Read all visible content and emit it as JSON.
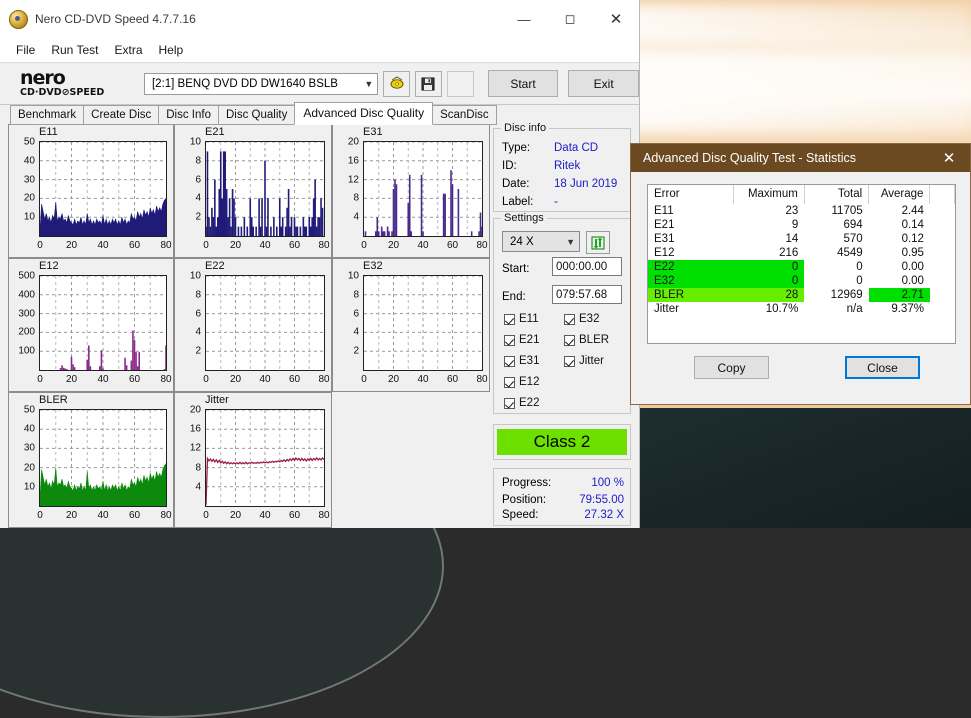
{
  "window": {
    "title": "Nero CD-DVD Speed 4.7.7.16",
    "app_icon": "nero-disc-icon",
    "minimize": "minimize-icon",
    "maximize": "maximize-icon",
    "close": "close-icon"
  },
  "menu": {
    "items": [
      "File",
      "Run Test",
      "Extra",
      "Help"
    ]
  },
  "brand": {
    "line1": "nero",
    "line2": "CD·DVD⊘SPEED",
    "drive_selected": "[2:1]   BENQ DVD DD DW1640 BSLB",
    "drive_caret": "chevron-down-icon",
    "tool_icon_1": "eject-disc-icon",
    "tool_icon_2": "save-floppy-icon",
    "start_label": "Start",
    "exit_label": "Exit"
  },
  "tabs": {
    "items": [
      "Benchmark",
      "Create Disc",
      "Disc Info",
      "Disc Quality",
      "Advanced Disc Quality",
      "ScanDisc"
    ],
    "active": "Advanced Disc Quality"
  },
  "disc_info": {
    "legend": "Disc info",
    "rows": [
      {
        "key": "Type:",
        "value": "Data CD"
      },
      {
        "key": "ID:",
        "value": "Ritek"
      },
      {
        "key": "Date:",
        "value": "18 Jun 2019"
      },
      {
        "key": "Label:",
        "value": "-"
      }
    ]
  },
  "settings": {
    "legend": "Settings",
    "speed_value": "24 X",
    "speed_caret": "chevron-down-icon",
    "refresh_icon": "refresh-speed-icon",
    "start_label": "Start:",
    "start_value": "000:00.00",
    "end_label": "End:",
    "end_value": "079:57.68",
    "checks_left": [
      "E11",
      "E21",
      "E31",
      "E12",
      "E22"
    ],
    "checks_right": [
      "E32",
      "BLER",
      "Jitter"
    ]
  },
  "class_badge": {
    "label": "Class 2",
    "color": "#6de000"
  },
  "status": {
    "rows": [
      {
        "key": "Progress:",
        "value": "100 %"
      },
      {
        "key": "Position:",
        "value": "79:55.00"
      },
      {
        "key": "Speed:",
        "value": "27.32 X"
      }
    ]
  },
  "dialog": {
    "title": "Advanced Disc Quality Test - Statistics",
    "close_icon": "close-icon",
    "columns": [
      "Error",
      "Maximum",
      "Total",
      "Average"
    ],
    "rows": [
      {
        "error": "E11",
        "maximum": "23",
        "total": "11705",
        "average": "2.44",
        "hl": "none"
      },
      {
        "error": "E21",
        "maximum": "9",
        "total": "694",
        "average": "0.14",
        "hl": "none"
      },
      {
        "error": "E31",
        "maximum": "14",
        "total": "570",
        "average": "0.12",
        "hl": "none"
      },
      {
        "error": "E12",
        "maximum": "216",
        "total": "4549",
        "average": "0.95",
        "hl": "none"
      },
      {
        "error": "E22",
        "maximum": "0",
        "total": "0",
        "average": "0.00",
        "hl": "green"
      },
      {
        "error": "E32",
        "maximum": "0",
        "total": "0",
        "average": "0.00",
        "hl": "green"
      },
      {
        "error": "BLER",
        "maximum": "28",
        "total": "12969",
        "average": "2.71",
        "hl": "lime-avg"
      },
      {
        "error": "Jitter",
        "maximum": "10.7%",
        "total": "n/a",
        "average": "9.37%",
        "hl": "none"
      }
    ],
    "copy_label": "Copy",
    "close_label": "Close",
    "highlight_green": "#00e000",
    "highlight_lime": "#66ee00"
  },
  "chart_data": [
    {
      "type": "area",
      "title": "E11",
      "color": "#201a78",
      "xlabel": "",
      "ylabel": "",
      "xlim": [
        0,
        80
      ],
      "ylim": [
        0,
        50
      ],
      "xticks": [
        0,
        20,
        40,
        60,
        80
      ],
      "yticks": [
        10,
        20,
        30,
        40,
        50
      ],
      "grid": true,
      "x": [
        0,
        1,
        2,
        3,
        4,
        5,
        6,
        7,
        8,
        9,
        10,
        11,
        12,
        13,
        14,
        15,
        16,
        17,
        18,
        19,
        20,
        21,
        22,
        23,
        24,
        25,
        26,
        27,
        28,
        29,
        30,
        31,
        32,
        33,
        34,
        35,
        36,
        37,
        38,
        39,
        40,
        41,
        42,
        43,
        44,
        45,
        46,
        47,
        48,
        49,
        50,
        51,
        52,
        53,
        54,
        55,
        56,
        57,
        58,
        59,
        60,
        61,
        62,
        63,
        64,
        65,
        66,
        67,
        68,
        69,
        70,
        71,
        72,
        73,
        74,
        75,
        76,
        77,
        78,
        79,
        80
      ],
      "values": [
        3,
        17,
        13,
        9,
        12,
        8,
        10,
        7,
        11,
        9,
        18,
        8,
        10,
        9,
        12,
        8,
        9,
        7,
        11,
        8,
        7,
        6,
        9,
        6,
        8,
        7,
        10,
        6,
        8,
        6,
        12,
        7,
        9,
        6,
        8,
        6,
        9,
        7,
        8,
        6,
        11,
        6,
        9,
        6,
        8,
        6,
        9,
        7,
        9,
        6,
        8,
        6,
        10,
        7,
        9,
        6,
        8,
        7,
        12,
        9,
        10,
        8,
        13,
        10,
        12,
        9,
        14,
        11,
        13,
        10,
        15,
        12,
        14,
        11,
        16,
        13,
        15,
        13,
        17,
        19,
        20
      ]
    },
    {
      "type": "bar",
      "title": "E21",
      "color": "#201a78",
      "xlim": [
        0,
        80
      ],
      "ylim": [
        0,
        10
      ],
      "xticks": [
        0,
        20,
        40,
        60,
        80
      ],
      "yticks": [
        2,
        4,
        6,
        8,
        10
      ],
      "grid": true,
      "x": [
        0,
        1,
        2,
        3,
        4,
        5,
        6,
        7,
        8,
        9,
        10,
        11,
        12,
        13,
        14,
        15,
        16,
        17,
        18,
        19,
        20,
        21,
        22,
        23,
        24,
        25,
        26,
        27,
        28,
        29,
        30,
        31,
        32,
        33,
        34,
        35,
        36,
        37,
        38,
        39,
        40,
        41,
        42,
        43,
        44,
        45,
        46,
        47,
        48,
        49,
        50,
        51,
        52,
        53,
        54,
        55,
        56,
        57,
        58,
        59,
        60,
        61,
        62,
        63,
        64,
        65,
        66,
        67,
        68,
        69,
        70,
        71,
        72,
        73,
        74,
        75,
        76,
        77,
        78,
        79,
        80
      ],
      "values": [
        1,
        9,
        2,
        1,
        3,
        2,
        6,
        1,
        2,
        5,
        9,
        4,
        9,
        9,
        5,
        2,
        4,
        1,
        5,
        4,
        2,
        0,
        1,
        0,
        1,
        0,
        2,
        0,
        1,
        0,
        4,
        2,
        1,
        0,
        1,
        0,
        4,
        1,
        4,
        0,
        8,
        1,
        4,
        0,
        1,
        0,
        2,
        0,
        1,
        0,
        4,
        1,
        2,
        0,
        1,
        3,
        5,
        1,
        2,
        0,
        2,
        1,
        1,
        0,
        1,
        0,
        2,
        1,
        1,
        0,
        2,
        1,
        2,
        4,
        6,
        1,
        2,
        2,
        4,
        3,
        0
      ]
    },
    {
      "type": "bar",
      "title": "E31",
      "color": "#4a2a8c",
      "xlim": [
        0,
        80
      ],
      "ylim": [
        0,
        20
      ],
      "xticks": [
        0,
        20,
        40,
        60,
        80
      ],
      "yticks": [
        4,
        8,
        12,
        16,
        20
      ],
      "grid": true,
      "x": [
        0,
        1,
        2,
        3,
        4,
        5,
        6,
        7,
        8,
        9,
        10,
        11,
        12,
        13,
        14,
        15,
        16,
        17,
        18,
        19,
        20,
        21,
        22,
        23,
        24,
        25,
        26,
        27,
        28,
        29,
        30,
        31,
        32,
        33,
        34,
        35,
        36,
        37,
        38,
        39,
        40,
        41,
        42,
        43,
        44,
        45,
        46,
        47,
        48,
        49,
        50,
        51,
        52,
        53,
        54,
        55,
        56,
        57,
        58,
        59,
        60,
        61,
        62,
        63,
        64,
        65,
        66,
        67,
        68,
        69,
        70,
        71,
        72,
        73,
        74,
        75,
        76,
        77,
        78,
        79,
        80
      ],
      "values": [
        0,
        1,
        0,
        0,
        0,
        0,
        0,
        0,
        1,
        4,
        1,
        0,
        2,
        1,
        1,
        0,
        2,
        1,
        0,
        1,
        10,
        12,
        11,
        0,
        0,
        0,
        0,
        0,
        0,
        0,
        7,
        13,
        1,
        0,
        0,
        0,
        0,
        0,
        0,
        13,
        1,
        0,
        0,
        0,
        0,
        0,
        0,
        0,
        0,
        0,
        0,
        0,
        0,
        0,
        9,
        9,
        0,
        0,
        0,
        14,
        11,
        0,
        0,
        0,
        10,
        0,
        0,
        0,
        0,
        0,
        0,
        0,
        0,
        1,
        0,
        0,
        0,
        0,
        1,
        5,
        2
      ]
    },
    {
      "type": "bar",
      "title": "E12",
      "color": "#8b2a8b",
      "xlim": [
        0,
        80
      ],
      "ylim": [
        0,
        500
      ],
      "xticks": [
        0,
        20,
        40,
        60,
        80
      ],
      "yticks": [
        100,
        200,
        300,
        400,
        500
      ],
      "grid": true,
      "x": [
        0,
        1,
        2,
        3,
        4,
        5,
        6,
        7,
        8,
        9,
        10,
        11,
        12,
        13,
        14,
        15,
        16,
        17,
        18,
        19,
        20,
        21,
        22,
        23,
        24,
        25,
        26,
        27,
        28,
        29,
        30,
        31,
        32,
        33,
        34,
        35,
        36,
        37,
        38,
        39,
        40,
        41,
        42,
        43,
        44,
        45,
        46,
        47,
        48,
        49,
        50,
        51,
        52,
        53,
        54,
        55,
        56,
        57,
        58,
        59,
        60,
        61,
        62,
        63,
        64,
        65,
        66,
        67,
        68,
        69,
        70,
        71,
        72,
        73,
        74,
        75,
        76,
        77,
        78,
        79,
        80
      ],
      "values": [
        0,
        0,
        0,
        0,
        0,
        0,
        0,
        0,
        0,
        0,
        0,
        0,
        0,
        10,
        25,
        12,
        8,
        5,
        0,
        0,
        70,
        30,
        15,
        0,
        0,
        0,
        0,
        0,
        0,
        0,
        55,
        130,
        20,
        0,
        0,
        0,
        0,
        0,
        20,
        105,
        8,
        0,
        0,
        0,
        0,
        0,
        0,
        0,
        0,
        0,
        0,
        0,
        0,
        0,
        65,
        25,
        0,
        0,
        50,
        210,
        160,
        95,
        20,
        95,
        0,
        0,
        0,
        0,
        0,
        0,
        0,
        0,
        0,
        0,
        0,
        0,
        0,
        0,
        0,
        5,
        130
      ]
    },
    {
      "type": "bar",
      "title": "E22",
      "color": "#201a78",
      "xlim": [
        0,
        80
      ],
      "ylim": [
        0,
        10
      ],
      "xticks": [
        0,
        20,
        40,
        60,
        80
      ],
      "yticks": [
        2,
        4,
        6,
        8,
        10
      ],
      "grid": true,
      "x": [
        0,
        20,
        40,
        60,
        80
      ],
      "values": [
        0,
        0,
        0,
        0,
        0
      ]
    },
    {
      "type": "bar",
      "title": "E32",
      "color": "#201a78",
      "xlim": [
        0,
        80
      ],
      "ylim": [
        0,
        10
      ],
      "xticks": [
        0,
        20,
        40,
        60,
        80
      ],
      "yticks": [
        2,
        4,
        6,
        8,
        10
      ],
      "grid": true,
      "x": [
        0,
        20,
        40,
        60,
        80
      ],
      "values": [
        0,
        0,
        0,
        0,
        0
      ]
    },
    {
      "type": "area",
      "title": "BLER",
      "color": "#0d8a0d",
      "xlim": [
        0,
        80
      ],
      "ylim": [
        0,
        50
      ],
      "xticks": [
        0,
        20,
        40,
        60,
        80
      ],
      "yticks": [
        10,
        20,
        30,
        40,
        50
      ],
      "grid": true,
      "x": [
        0,
        1,
        2,
        3,
        4,
        5,
        6,
        7,
        8,
        9,
        10,
        11,
        12,
        13,
        14,
        15,
        16,
        17,
        18,
        19,
        20,
        21,
        22,
        23,
        24,
        25,
        26,
        27,
        28,
        29,
        30,
        31,
        32,
        33,
        34,
        35,
        36,
        37,
        38,
        39,
        40,
        41,
        42,
        43,
        44,
        45,
        46,
        47,
        48,
        49,
        50,
        51,
        52,
        53,
        54,
        55,
        56,
        57,
        58,
        59,
        60,
        61,
        62,
        63,
        64,
        65,
        66,
        67,
        68,
        69,
        70,
        71,
        72,
        73,
        74,
        75,
        76,
        77,
        78,
        79,
        80
      ],
      "values": [
        4,
        19,
        15,
        11,
        14,
        10,
        12,
        9,
        13,
        11,
        20,
        10,
        12,
        11,
        14,
        10,
        11,
        9,
        13,
        10,
        9,
        8,
        11,
        8,
        10,
        9,
        12,
        8,
        10,
        8,
        18,
        9,
        11,
        8,
        10,
        8,
        11,
        9,
        10,
        8,
        13,
        8,
        11,
        8,
        10,
        8,
        11,
        9,
        11,
        8,
        10,
        8,
        12,
        9,
        11,
        8,
        10,
        9,
        14,
        11,
        12,
        10,
        15,
        12,
        14,
        11,
        16,
        13,
        15,
        12,
        17,
        14,
        16,
        13,
        18,
        15,
        17,
        15,
        19,
        21,
        22
      ]
    },
    {
      "type": "line",
      "title": "Jitter",
      "color": "#9b1b4a",
      "xlim": [
        0,
        80
      ],
      "ylim": [
        0,
        20
      ],
      "xticks": [
        0,
        20,
        40,
        60,
        80
      ],
      "yticks": [
        4,
        8,
        12,
        16,
        20
      ],
      "grid": true,
      "x": [
        0,
        1,
        2,
        3,
        4,
        5,
        6,
        7,
        8,
        9,
        10,
        11,
        12,
        13,
        14,
        15,
        16,
        17,
        18,
        19,
        20,
        21,
        22,
        23,
        24,
        25,
        26,
        27,
        28,
        29,
        30,
        31,
        32,
        33,
        34,
        35,
        36,
        37,
        38,
        39,
        40,
        41,
        42,
        43,
        44,
        45,
        46,
        47,
        48,
        49,
        50,
        51,
        52,
        53,
        54,
        55,
        56,
        57,
        58,
        59,
        60,
        61,
        62,
        63,
        64,
        65,
        66,
        67,
        68,
        69,
        70,
        71,
        72,
        73,
        74,
        75,
        76,
        77,
        78,
        79,
        80
      ],
      "values": [
        0.2,
        9.9,
        9.4,
        9.8,
        9.3,
        9.7,
        9.2,
        9.6,
        9.1,
        9.5,
        9.0,
        9.3,
        8.9,
        9.2,
        8.8,
        9.1,
        8.8,
        9.0,
        8.8,
        9.0,
        8.8,
        9.0,
        8.8,
        9.1,
        8.8,
        9.0,
        8.8,
        9.1,
        8.8,
        9.0,
        8.9,
        9.1,
        8.9,
        9.0,
        8.9,
        9.1,
        8.9,
        9.1,
        9.0,
        9.2,
        9.0,
        9.2,
        9.0,
        9.2,
        9.1,
        9.3,
        9.1,
        9.3,
        9.2,
        9.4,
        9.2,
        9.5,
        9.3,
        9.6,
        9.3,
        9.7,
        9.4,
        9.8,
        9.5,
        9.9,
        9.5,
        10.0,
        9.6,
        9.9,
        9.5,
        9.9,
        9.5,
        9.8,
        9.4,
        9.8,
        9.5,
        9.9,
        9.5,
        9.9,
        9.6,
        10.0,
        9.6,
        9.9,
        9.6,
        10.0,
        9.7
      ]
    }
  ]
}
